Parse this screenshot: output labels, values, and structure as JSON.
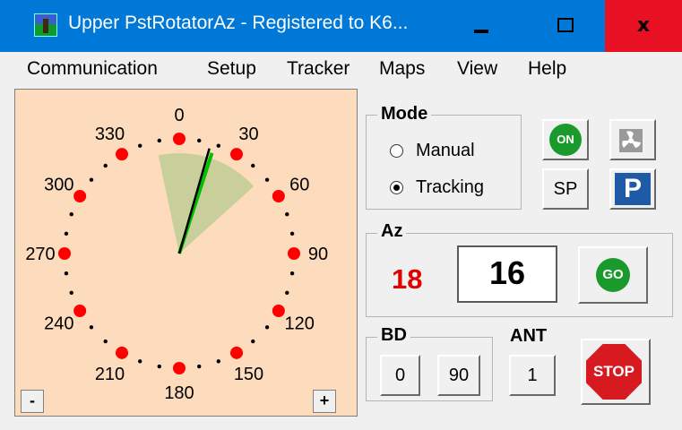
{
  "window": {
    "title": "Upper PstRotatorAz - Registered to K6...",
    "minimize_icon": "minimize-icon",
    "maximize_icon": "maximize-icon",
    "close_label": "x"
  },
  "menu": [
    "Communication",
    "Setup",
    "Tracker",
    "Maps",
    "View",
    "Help"
  ],
  "compass": {
    "labels": [
      "0",
      "30",
      "60",
      "90",
      "120",
      "150",
      "180",
      "210",
      "240",
      "270",
      "300",
      "330"
    ],
    "heading_deg": 16,
    "target_deg": 18,
    "beamwidth_deg": 60,
    "zoom_out_label": "-",
    "zoom_in_label": "+",
    "colors": {
      "background": "#fddcbd",
      "marker": "#ff0000",
      "beam": "#c9cf9b",
      "needle": "#000000",
      "target_needle": "#00c000"
    }
  },
  "mode": {
    "label": "Mode",
    "options": [
      "Manual",
      "Tracking"
    ],
    "selected": "Tracking"
  },
  "buttons": {
    "on_label": "ON",
    "fan_icon": "fan-icon",
    "sp_label": "SP",
    "park_label": "P",
    "go_label": "GO",
    "stop_label": "STOP"
  },
  "az": {
    "label": "Az",
    "current": "18",
    "input_value": "16"
  },
  "bd": {
    "label": "BD",
    "buttons": [
      "0",
      "90"
    ]
  },
  "ant": {
    "label": "ANT",
    "value": "1"
  }
}
